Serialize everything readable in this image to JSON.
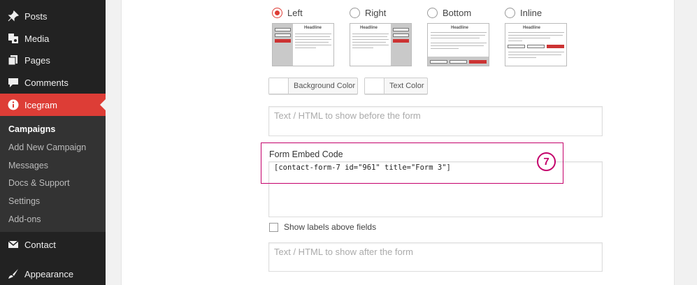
{
  "sidebar": {
    "items": [
      {
        "label": "Posts",
        "icon": "pin-icon"
      },
      {
        "label": "Media",
        "icon": "media-icon"
      },
      {
        "label": "Pages",
        "icon": "pages-icon"
      },
      {
        "label": "Comments",
        "icon": "comment-icon"
      },
      {
        "label": "Icegram",
        "icon": "info-icon"
      },
      {
        "label": "Contact",
        "icon": "mail-icon"
      },
      {
        "label": "Appearance",
        "icon": "brush-icon"
      }
    ],
    "submenu": [
      "Campaigns",
      "Add New Campaign",
      "Messages",
      "Docs & Support",
      "Settings",
      "Add-ons"
    ],
    "accent_color": "#dd3d36"
  },
  "form_position": {
    "options": [
      "Left",
      "Right",
      "Bottom",
      "Inline"
    ],
    "selected": "Left",
    "thumb_headline": "Headline",
    "thumb_button": "Submit"
  },
  "colors": {
    "background_label": "Background Color",
    "text_label": "Text Color"
  },
  "before_form": {
    "placeholder": "Text / HTML to show before the form"
  },
  "embed": {
    "label": "Form Embed Code",
    "code": "[contact-form-7 id=\"961\" title=\"Form 3\"]",
    "step_number": "7",
    "highlight_color": "#c4006b"
  },
  "show_labels": {
    "label": "Show labels above fields",
    "checked": false
  },
  "after_form": {
    "placeholder": "Text / HTML to show after the form"
  }
}
